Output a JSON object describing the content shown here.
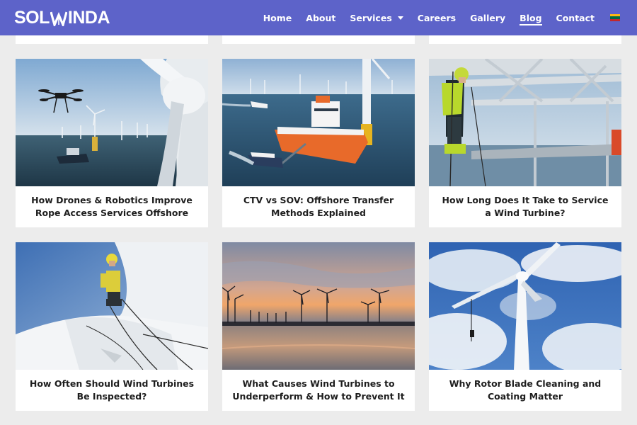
{
  "brand": {
    "logo_text_left": "SOL",
    "logo_text_right": "INDA"
  },
  "nav": {
    "items": [
      {
        "label": "Home"
      },
      {
        "label": "About"
      },
      {
        "label": "Services"
      },
      {
        "label": "Careers"
      },
      {
        "label": "Gallery"
      },
      {
        "label": "Blog"
      },
      {
        "label": "Contact"
      }
    ],
    "active": "Blog",
    "language_flag": "lithuania-flag-icon"
  },
  "colors": {
    "header_bg": "#5d63c9",
    "page_bg": "#ececec",
    "card_bg": "#ffffff",
    "title_text": "#1e1e1e"
  },
  "posts": [
    {
      "title": "How Drones & Robotics Improve Rope Access Services Offshore",
      "image": "drone-over-offshore-wind-farm-photo"
    },
    {
      "title": "CTV vs SOV: Offshore Transfer Methods Explained",
      "image": "service-vessel-and-ctv-at-wind-farm-photo"
    },
    {
      "title": "How Long Does It Take to Service a Wind Turbine?",
      "image": "technician-on-platform-steel-structure-photo"
    },
    {
      "title": "How Often Should Wind Turbines Be Inspected?",
      "image": "technician-on-turbine-nacelle-photo"
    },
    {
      "title": "What Causes Wind Turbines to Underperform & How to Prevent It",
      "image": "wind-farm-at-sunset-photo"
    },
    {
      "title": "Why Rotor Blade Cleaning and Coating Matter",
      "image": "rope-access-on-turbine-blade-photo"
    }
  ]
}
